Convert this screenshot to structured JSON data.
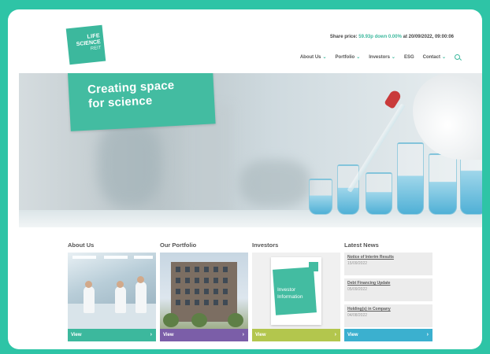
{
  "site": {
    "logo": {
      "line1": "LIFE",
      "line2": "SCIENCE",
      "line3": "REIT"
    },
    "share_price": {
      "prefix": "Share price: ",
      "value": "59.93p down 0.00%",
      "suffix": " at 20/09/2022, 09:00:06"
    },
    "nav": [
      {
        "label": "About Us"
      },
      {
        "label": "Portfolio"
      },
      {
        "label": "Investors"
      },
      {
        "label": "ESG"
      },
      {
        "label": "Contact"
      }
    ]
  },
  "hero": {
    "line1": "Creating space",
    "line2": "for science"
  },
  "sections": {
    "about": {
      "title": "About Us",
      "cta": "View"
    },
    "portfolio": {
      "title": "Our Portfolio",
      "cta": "View"
    },
    "investors": {
      "title": "Investors",
      "cta": "View",
      "doc_line1": "Investor",
      "doc_line2": "Information"
    },
    "news": {
      "title": "Latest News",
      "cta": "View",
      "items": [
        {
          "title": "Notice of Interim Results",
          "date": "15/09/2022"
        },
        {
          "title": "Debt Financing Update",
          "date": "05/09/2022"
        },
        {
          "title": "Holding(s) in Company",
          "date": "04/08/2022"
        }
      ]
    }
  },
  "colors": {
    "brand": "#3cb89d",
    "outer_background": "#2ec4a6",
    "portfolio_bar": "#7b5ea8",
    "investors_bar": "#b3c64d",
    "news_bar": "#3bb0cf"
  }
}
